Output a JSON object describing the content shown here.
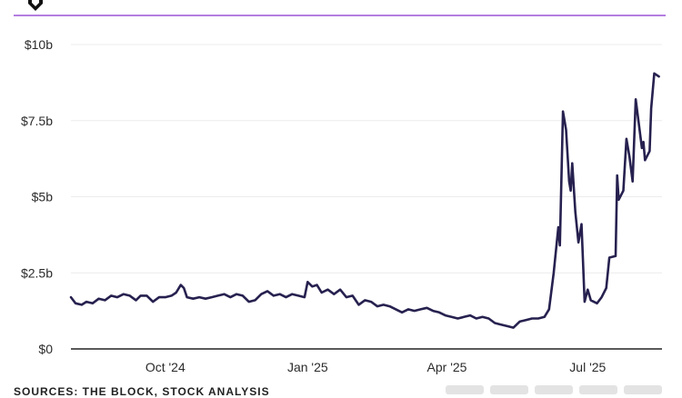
{
  "source_text": "SOURCES: THE BLOCK, STOCK ANALYSIS",
  "colors": {
    "line": "#26214f",
    "rule": "#b37fe0",
    "grid": "#ececec",
    "axis": "#222222",
    "button": "#e3e3e3"
  },
  "icons": {
    "logo": "the-block-logo-icon"
  },
  "chart_data": {
    "type": "line",
    "title": "",
    "xlabel": "",
    "ylabel": "",
    "ylim": [
      0,
      10
    ],
    "yticks": [
      {
        "value": 0,
        "label": "$0"
      },
      {
        "value": 2.5,
        "label": "$2.5b"
      },
      {
        "value": 5,
        "label": "$5b"
      },
      {
        "value": 7.5,
        "label": "$7.5b"
      },
      {
        "value": 10,
        "label": "$10b"
      }
    ],
    "xlim": [
      "2024-08-01",
      "2025-08-18"
    ],
    "xticks": [
      {
        "value": "2024-10-01",
        "label": "Oct '24"
      },
      {
        "value": "2025-01-01",
        "label": "Jan '25"
      },
      {
        "value": "2025-04-01",
        "label": "Apr '25"
      },
      {
        "value": "2025-07-01",
        "label": "Jul '25"
      }
    ],
    "grid": true,
    "series": [
      {
        "values": [
          [
            "2024-08-01",
            1.7
          ],
          [
            "2024-08-04",
            1.5
          ],
          [
            "2024-08-08",
            1.45
          ],
          [
            "2024-08-11",
            1.55
          ],
          [
            "2024-08-15",
            1.5
          ],
          [
            "2024-08-19",
            1.65
          ],
          [
            "2024-08-23",
            1.6
          ],
          [
            "2024-08-27",
            1.75
          ],
          [
            "2024-08-31",
            1.7
          ],
          [
            "2024-09-04",
            1.8
          ],
          [
            "2024-09-08",
            1.75
          ],
          [
            "2024-09-12",
            1.6
          ],
          [
            "2024-09-15",
            1.75
          ],
          [
            "2024-09-19",
            1.75
          ],
          [
            "2024-09-23",
            1.55
          ],
          [
            "2024-09-27",
            1.7
          ],
          [
            "2024-10-01",
            1.7
          ],
          [
            "2024-10-05",
            1.75
          ],
          [
            "2024-10-08",
            1.85
          ],
          [
            "2024-10-11",
            2.1
          ],
          [
            "2024-10-13",
            2.0
          ],
          [
            "2024-10-15",
            1.7
          ],
          [
            "2024-10-19",
            1.65
          ],
          [
            "2024-10-23",
            1.7
          ],
          [
            "2024-10-27",
            1.65
          ],
          [
            "2024-10-31",
            1.7
          ],
          [
            "2024-11-04",
            1.75
          ],
          [
            "2024-11-08",
            1.8
          ],
          [
            "2024-11-12",
            1.7
          ],
          [
            "2024-11-16",
            1.8
          ],
          [
            "2024-11-20",
            1.75
          ],
          [
            "2024-11-24",
            1.55
          ],
          [
            "2024-11-28",
            1.6
          ],
          [
            "2024-12-02",
            1.8
          ],
          [
            "2024-12-06",
            1.9
          ],
          [
            "2024-12-10",
            1.75
          ],
          [
            "2024-12-14",
            1.8
          ],
          [
            "2024-12-18",
            1.7
          ],
          [
            "2024-12-22",
            1.8
          ],
          [
            "2024-12-26",
            1.75
          ],
          [
            "2024-12-30",
            1.7
          ],
          [
            "2025-01-01",
            2.2
          ],
          [
            "2025-01-04",
            2.05
          ],
          [
            "2025-01-07",
            2.1
          ],
          [
            "2025-01-10",
            1.85
          ],
          [
            "2025-01-14",
            1.95
          ],
          [
            "2025-01-18",
            1.8
          ],
          [
            "2025-01-22",
            1.95
          ],
          [
            "2025-01-26",
            1.7
          ],
          [
            "2025-01-30",
            1.75
          ],
          [
            "2025-02-03",
            1.45
          ],
          [
            "2025-02-07",
            1.6
          ],
          [
            "2025-02-11",
            1.55
          ],
          [
            "2025-02-15",
            1.4
          ],
          [
            "2025-02-19",
            1.45
          ],
          [
            "2025-02-23",
            1.4
          ],
          [
            "2025-02-27",
            1.3
          ],
          [
            "2025-03-03",
            1.2
          ],
          [
            "2025-03-07",
            1.3
          ],
          [
            "2025-03-11",
            1.25
          ],
          [
            "2025-03-15",
            1.3
          ],
          [
            "2025-03-19",
            1.35
          ],
          [
            "2025-03-23",
            1.25
          ],
          [
            "2025-03-27",
            1.2
          ],
          [
            "2025-03-31",
            1.1
          ],
          [
            "2025-04-04",
            1.05
          ],
          [
            "2025-04-08",
            1.0
          ],
          [
            "2025-04-12",
            1.05
          ],
          [
            "2025-04-16",
            1.1
          ],
          [
            "2025-04-20",
            1.0
          ],
          [
            "2025-04-24",
            1.05
          ],
          [
            "2025-04-28",
            1.0
          ],
          [
            "2025-05-02",
            0.85
          ],
          [
            "2025-05-06",
            0.8
          ],
          [
            "2025-05-10",
            0.75
          ],
          [
            "2025-05-14",
            0.7
          ],
          [
            "2025-05-18",
            0.9
          ],
          [
            "2025-05-22",
            0.95
          ],
          [
            "2025-05-26",
            1.0
          ],
          [
            "2025-05-30",
            1.0
          ],
          [
            "2025-06-03",
            1.05
          ],
          [
            "2025-06-06",
            1.3
          ],
          [
            "2025-06-09",
            2.5
          ],
          [
            "2025-06-12",
            4.0
          ],
          [
            "2025-06-13",
            3.4
          ],
          [
            "2025-06-15",
            7.8
          ],
          [
            "2025-06-17",
            7.2
          ],
          [
            "2025-06-19",
            5.5
          ],
          [
            "2025-06-20",
            5.2
          ],
          [
            "2025-06-21",
            6.1
          ],
          [
            "2025-06-23",
            4.5
          ],
          [
            "2025-06-25",
            3.5
          ],
          [
            "2025-06-27",
            4.1
          ],
          [
            "2025-06-29",
            1.55
          ],
          [
            "2025-07-01",
            1.95
          ],
          [
            "2025-07-03",
            1.6
          ],
          [
            "2025-07-07",
            1.5
          ],
          [
            "2025-07-10",
            1.7
          ],
          [
            "2025-07-13",
            2.0
          ],
          [
            "2025-07-15",
            3.0
          ],
          [
            "2025-07-19",
            3.05
          ],
          [
            "2025-07-20",
            5.7
          ],
          [
            "2025-07-21",
            4.9
          ],
          [
            "2025-07-24",
            5.2
          ],
          [
            "2025-07-26",
            6.9
          ],
          [
            "2025-07-28",
            6.3
          ],
          [
            "2025-07-30",
            5.5
          ],
          [
            "2025-08-01",
            8.2
          ],
          [
            "2025-08-03",
            7.4
          ],
          [
            "2025-08-05",
            6.6
          ],
          [
            "2025-08-06",
            6.8
          ],
          [
            "2025-08-07",
            6.2
          ],
          [
            "2025-08-10",
            6.5
          ],
          [
            "2025-08-11",
            7.9
          ],
          [
            "2025-08-13",
            9.05
          ],
          [
            "2025-08-16",
            8.95
          ]
        ]
      }
    ]
  }
}
